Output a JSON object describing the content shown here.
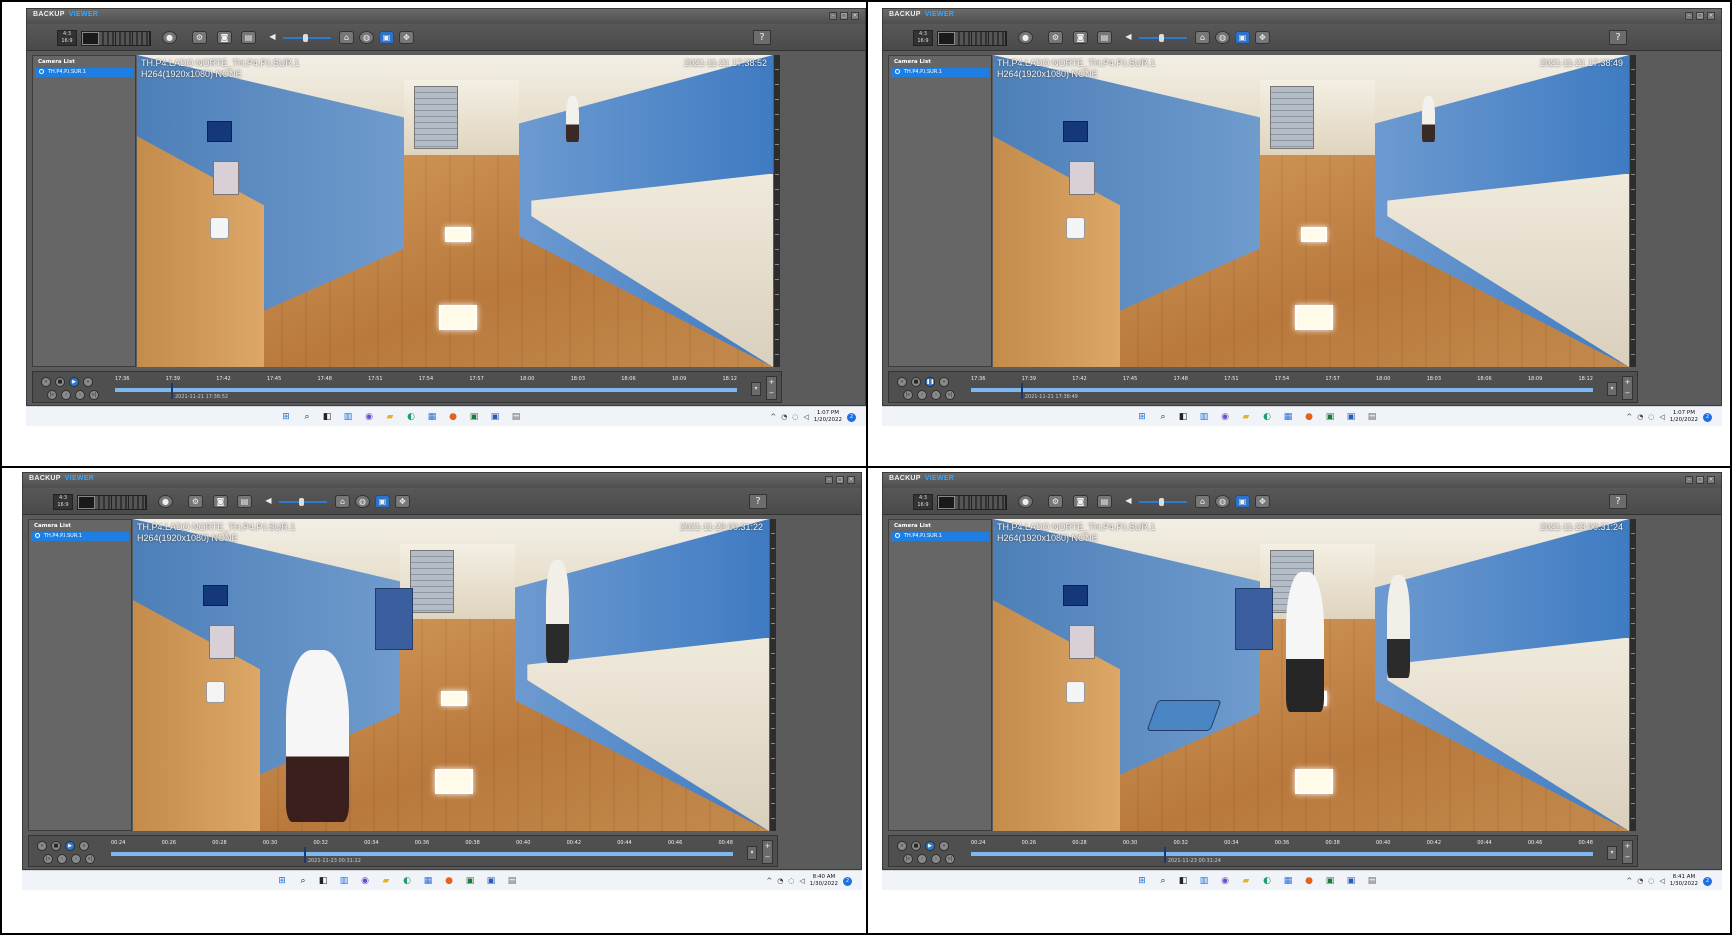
{
  "colors": {
    "accent": "#35a7ff",
    "selection": "#1f7fe0",
    "panel": "#5b5b5b",
    "timeline": "#7fb7ef"
  },
  "icons": {
    "toolbar": [
      "camera-ring-icon",
      "settings-icon",
      "snapshot-icon",
      "print-icon",
      "speaker-icon",
      "dewarp-icon",
      "globe-icon",
      "fullscreen-icon",
      "expand-icon"
    ],
    "playback": [
      "rewind-icon",
      "stop-icon",
      "play-icon",
      "fast-forward-icon",
      "skip-back-icon",
      "step-back-icon",
      "step-forward-icon",
      "skip-forward-icon"
    ],
    "taskbar": [
      "windows-start-icon",
      "search-icon",
      "task-view-icon",
      "widgets-icon",
      "chat-icon",
      "file-explorer-icon",
      "edge-icon",
      "store-icon",
      "firefox-icon",
      "excel-icon",
      "word-icon",
      "viewer-app-icon"
    ]
  },
  "panels": [
    {
      "app_title": "BACKUP",
      "app_title_accent": "VIEWER",
      "aspect": "4:3\n16:9",
      "camera_list_header": "Camera List",
      "camera_item": "TH.P4.P.I.SUR.1",
      "osd_camera": "TH.P4.LADO NORTE_TH.P4.P.I.SUR.1",
      "osd_codec": "H264(1920x1080)  NONE",
      "osd_timestamp": "2021-11-21 17:38:52",
      "timeline_ticks": [
        "17:36",
        "17:39",
        "17:42",
        "17:45",
        "17:48",
        "17:51",
        "17:54",
        "17:57",
        "18:00",
        "18:03",
        "18:06",
        "18:09",
        "18:12"
      ],
      "timeline_label": "2021-11-21 17:38:52",
      "marker_position": 0.09,
      "paused": false,
      "clock_time": "1:07 PM",
      "clock_date": "1/20/2022",
      "people": 1
    },
    {
      "app_title": "BACKUP",
      "app_title_accent": "VIEWER",
      "aspect": "4:3\n16:9",
      "camera_list_header": "Camera List",
      "camera_item": "TH.P4.P.I.SUR.1",
      "osd_camera": "TH.P4.LADO NORTE_TH.P4.P.I.SUR.1",
      "osd_codec": "H264(1920x1080)  NONE",
      "osd_timestamp": "2021-11-21 17:38:49",
      "timeline_ticks": [
        "17:36",
        "17:39",
        "17:42",
        "17:45",
        "17:48",
        "17:51",
        "17:54",
        "17:57",
        "18:00",
        "18:03",
        "18:06",
        "18:09",
        "18:12"
      ],
      "timeline_label": "2021-11-21 17:38:49",
      "marker_position": 0.08,
      "paused": true,
      "clock_time": "1:07 PM",
      "clock_date": "1/20/2022",
      "people": 1
    },
    {
      "app_title": "BACKUP",
      "app_title_accent": "VIEWER",
      "aspect": "4:3\n16:9",
      "camera_list_header": "Camera List",
      "camera_item": "TH.P4.P.I.SUR.1",
      "osd_camera": "TH.P4.LADO NORTE_TH.P4.P.I.SUR.1",
      "osd_codec": "H264(1920x1080)  NONE",
      "osd_timestamp": "2021-11-23 00:31:22",
      "timeline_ticks": [
        "00:24",
        "00:26",
        "00:28",
        "00:30",
        "00:32",
        "00:34",
        "00:36",
        "00:38",
        "00:40",
        "00:42",
        "00:44",
        "00:46",
        "00:48"
      ],
      "timeline_label": "2021-11-23 00:31:22",
      "marker_position": 0.31,
      "paused": false,
      "clock_time": "8:40 AM",
      "clock_date": "1/30/2022",
      "people": 2
    },
    {
      "app_title": "BACKUP",
      "app_title_accent": "VIEWER",
      "aspect": "4:3\n16:9",
      "camera_list_header": "Camera List",
      "camera_item": "TH.P4.P.I.SUR.1",
      "osd_camera": "TH.P4.LADO NORTE_TH.P4.P.I.SUR.1",
      "osd_codec": "H264(1920x1080)  NONE",
      "osd_timestamp": "2021-11-23 00:31:24",
      "timeline_ticks": [
        "00:24",
        "00:26",
        "00:28",
        "00:30",
        "00:32",
        "00:34",
        "00:36",
        "00:38",
        "00:40",
        "00:42",
        "00:44",
        "00:46",
        "00:48"
      ],
      "timeline_label": "2021-11-23 00:31:24",
      "marker_position": 0.31,
      "paused": false,
      "clock_time": "8:41 AM",
      "clock_date": "1/30/2022",
      "people": 2
    }
  ]
}
